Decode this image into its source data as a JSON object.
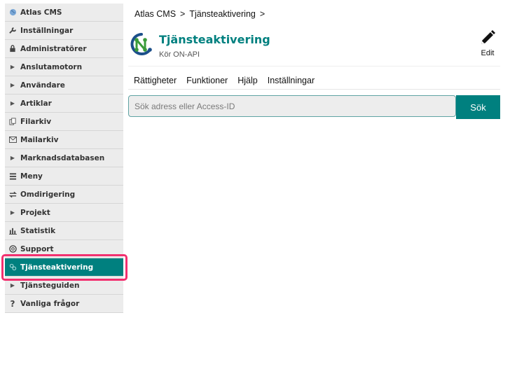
{
  "sidebar": {
    "items": [
      {
        "label": "Atlas CMS",
        "icon": "globe-icon"
      },
      {
        "label": "Inställningar",
        "icon": "wrench-icon"
      },
      {
        "label": "Administratörer",
        "icon": "lock-icon"
      },
      {
        "label": "Anslutamotorn",
        "icon": "caret-right-icon"
      },
      {
        "label": "Användare",
        "icon": "caret-right-icon"
      },
      {
        "label": "Artiklar",
        "icon": "caret-right-icon"
      },
      {
        "label": "Filarkiv",
        "icon": "files-icon"
      },
      {
        "label": "Mailarkiv",
        "icon": "envelope-icon"
      },
      {
        "label": "Marknadsdatabasen",
        "icon": "caret-right-icon"
      },
      {
        "label": "Meny",
        "icon": "menu-list-icon"
      },
      {
        "label": "Omdirigering",
        "icon": "swap-arrows-icon"
      },
      {
        "label": "Projekt",
        "icon": "caret-right-icon"
      },
      {
        "label": "Statistik",
        "icon": "bar-chart-icon"
      },
      {
        "label": "Support",
        "icon": "lifebuoy-icon"
      },
      {
        "label": "Tjänsteaktivering",
        "icon": "activation-icon"
      },
      {
        "label": "Tjänsteguiden",
        "icon": "caret-right-icon"
      },
      {
        "label": "Vanliga frågor",
        "icon": "question-icon"
      }
    ],
    "active_index": 14
  },
  "breadcrumb": {
    "items": [
      "Atlas CMS",
      "Tjänsteaktivering"
    ],
    "separator": ">"
  },
  "header": {
    "title": "Tjänsteaktivering",
    "subtitle": "Kör ON-API",
    "edit_label": "Edit"
  },
  "tabs": [
    "Rättigheter",
    "Funktioner",
    "Hjälp",
    "Inställningar"
  ],
  "search": {
    "placeholder": "Sök adress eller Access-ID",
    "value": "",
    "button_label": "Sök"
  },
  "colors": {
    "accent": "#00807f",
    "highlight": "#f2306f",
    "sidebar_bg": "#ececec"
  }
}
